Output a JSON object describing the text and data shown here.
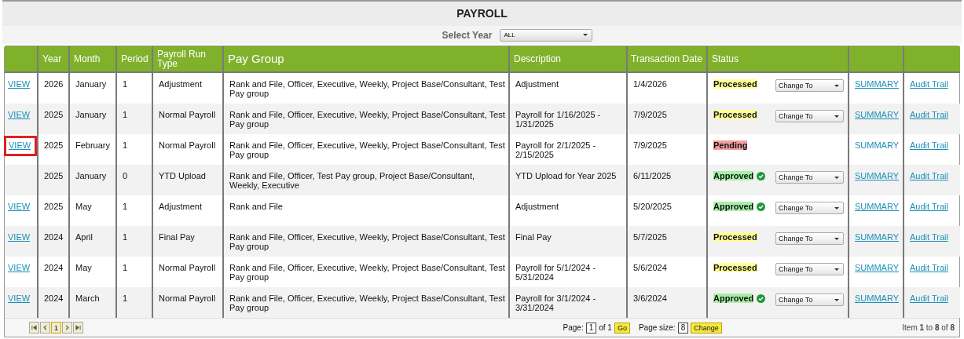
{
  "title": "PAYROLL",
  "year_filter": {
    "label": "Select Year",
    "value": "ALL"
  },
  "columns": [
    "",
    "Year",
    "Month",
    "Period",
    "Payroll Run Type",
    "Pay Group",
    "Description",
    "Transaction Date",
    "Status",
    "",
    ""
  ],
  "rows": [
    {
      "view": "VIEW",
      "highlighted": false,
      "year": "2026",
      "month": "January",
      "period": "1",
      "run_type": "Adjustment",
      "pay_group": "Rank and File, Officer, Executive, Weekly, Project Base/Consultant, Test Pay group",
      "description": "Adjustment",
      "date": "1/4/2026",
      "status": "Processed",
      "color": "#ffff99",
      "verified": false,
      "change_to": "Change To",
      "summary": "SUMMARY",
      "summary_linked": true,
      "audit": "Audit Trail"
    },
    {
      "view": "VIEW",
      "highlighted": false,
      "year": "2025",
      "month": "January",
      "period": "1",
      "run_type": "Normal Payroll",
      "pay_group": "Rank and File, Officer, Executive, Weekly, Project Base/Consultant, Test Pay group",
      "description": "Payroll for 1/16/2025 - 1/31/2025",
      "date": "7/9/2025",
      "status": "Processed",
      "color": "#ffff99",
      "verified": false,
      "change_to": "Change To",
      "summary": "SUMMARY",
      "summary_linked": true,
      "audit": "Audit Trail"
    },
    {
      "view": "VIEW",
      "highlighted": true,
      "year": "2025",
      "month": "February",
      "period": "1",
      "run_type": "Normal Payroll",
      "pay_group": "Rank and File, Officer, Executive, Weekly, Project Base/Consultant, Test Pay group",
      "description": "Payroll for 2/1/2025 - 2/15/2025",
      "date": "7/9/2025",
      "status": "Pending",
      "color": "#f4a0a0",
      "verified": false,
      "summary": "SUMMARY",
      "summary_linked": false,
      "audit": "Audit Trail"
    },
    {
      "year": "2025",
      "month": "January",
      "period": "0",
      "run_type": "YTD Upload",
      "pay_group": "Rank and File, Officer, Test Pay group, Project Base/Consultant, Weekly, Executive",
      "description": "YTD Upload for Year 2025",
      "date": "6/11/2025",
      "status": "Approved",
      "color": "#a8f0a8",
      "verified": true,
      "change_to": "Change To",
      "summary": "SUMMARY",
      "summary_linked": true,
      "audit": "Audit Trail"
    },
    {
      "view": "VIEW",
      "highlighted": false,
      "year": "2025",
      "month": "May",
      "period": "1",
      "run_type": "Adjustment",
      "pay_group": "Rank and File",
      "description": "Adjustment",
      "date": "5/20/2025",
      "status": "Approved",
      "color": "#a8f0a8",
      "verified": true,
      "change_to": "Change To",
      "summary": "SUMMARY",
      "summary_linked": true,
      "audit": "Audit Trail"
    },
    {
      "view": "VIEW",
      "highlighted": false,
      "year": "2024",
      "month": "April",
      "period": "1",
      "run_type": "Final Pay",
      "pay_group": "Rank and File, Officer, Executive, Weekly, Project Base/Consultant, Test Pay group",
      "description": "Final Pay",
      "date": "5/7/2025",
      "status": "Processed",
      "color": "#ffff99",
      "verified": false,
      "change_to": "Change To",
      "summary": "SUMMARY",
      "summary_linked": true,
      "audit": "Audit Trail"
    },
    {
      "view": "VIEW",
      "highlighted": false,
      "year": "2024",
      "month": "May",
      "period": "1",
      "run_type": "Normal Payroll",
      "pay_group": "Rank and File, Officer, Executive, Weekly, Project Base/Consultant, Test Pay group",
      "description": "Payroll for 5/1/2024 - 5/31/2024",
      "date": "5/6/2024",
      "status": "Processed",
      "color": "#ffff99",
      "verified": false,
      "change_to": "Change To",
      "summary": "SUMMARY",
      "summary_linked": true,
      "audit": "Audit Trail"
    },
    {
      "view": "VIEW",
      "highlighted": false,
      "year": "2024",
      "month": "March",
      "period": "1",
      "run_type": "Normal Payroll",
      "pay_group": "Rank and File, Officer, Executive, Weekly, Project Base/Consultant, Test Pay group",
      "description": "Payroll for 3/1/2024 - 3/31/2024",
      "date": "3/6/2024",
      "status": "Approved",
      "color": "#a8f0a8",
      "verified": true,
      "change_to": "Change To",
      "summary": "SUMMARY",
      "summary_linked": true,
      "audit": "Audit Trail"
    }
  ],
  "pager": {
    "current_page": "1",
    "page_label": "Page:",
    "page_value": "1",
    "of_label": "of 1",
    "go": "Go",
    "size_label": "Page size:",
    "size_value": "8",
    "change": "Change",
    "summary": "Item **1** to **8** of **8**"
  }
}
